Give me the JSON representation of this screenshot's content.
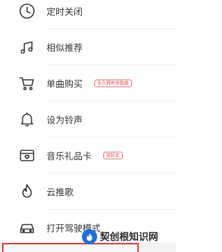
{
  "menu": {
    "items": [
      {
        "label": "定时关闭",
        "icon": "clock-icon"
      },
      {
        "label": "相似推荐",
        "icon": "music-notes-icon"
      },
      {
        "label": "单曲购买",
        "icon": "shopping-cart-icon",
        "tag": "永久拥有该歌曲"
      },
      {
        "label": "设为铃声",
        "icon": "bell-icon"
      },
      {
        "label": "音乐礼品卡",
        "icon": "gift-card-icon",
        "tag": "送好友"
      },
      {
        "label": "云推歌",
        "icon": "flame-icon"
      },
      {
        "label": "打开驾驶模式",
        "icon": "car-icon"
      }
    ]
  },
  "watermark": {
    "text": "契创根知识网",
    "icon": "watermark-logo-icon"
  },
  "colors": {
    "text": "#333333",
    "icon_stroke": "#333333",
    "tag_red": "#e05050",
    "highlight_border": "#d63a3a",
    "divider": "#ececec"
  }
}
